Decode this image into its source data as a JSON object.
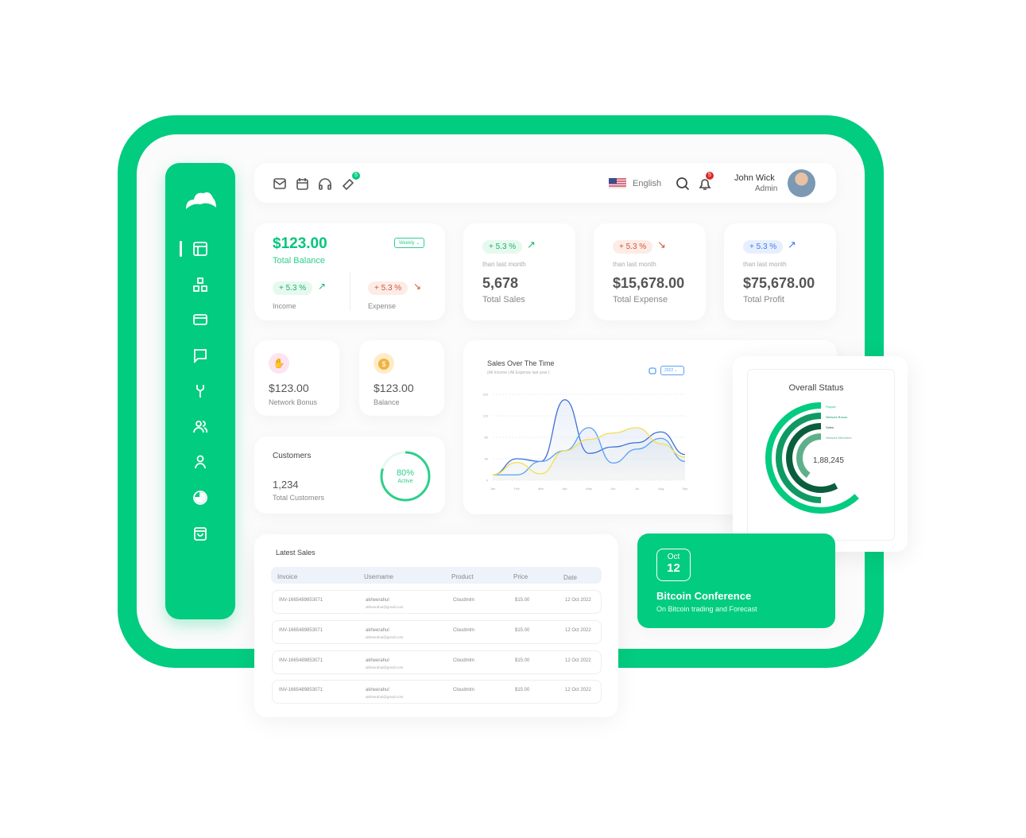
{
  "header": {
    "ticket_badge": "5",
    "language": "English",
    "notification_badge": "5",
    "user_name": "John Wick",
    "user_role": "Admin"
  },
  "sidebar": {
    "items": [
      "dashboard-icon",
      "network-icon",
      "card-icon",
      "chat-icon",
      "tools-icon",
      "users-icon",
      "user-icon",
      "chart-pie-icon",
      "shopping-bag-icon"
    ]
  },
  "balance": {
    "amount": "$123.00",
    "label": "Total Balance",
    "period": "Weekly",
    "income_change": "+ 5.3 %",
    "income_label": "Income",
    "expense_change": "+ 5.3 %",
    "expense_label": "Expense"
  },
  "stats": [
    {
      "change": "+ 5.3 %",
      "note": "than last month",
      "value": "5,678",
      "label": "Total Sales",
      "trend": "up",
      "color": "#1eb36b"
    },
    {
      "change": "+ 5.3 %",
      "note": "than last month",
      "value": "$15,678.00",
      "label": "Total Expense",
      "trend": "down",
      "color": "#d0573a"
    },
    {
      "change": "+ 5.3 %",
      "note": "than last month",
      "value": "$75,678.00",
      "label": "Total Profit",
      "trend": "up",
      "color": "#3f7bf0"
    }
  ],
  "mini": [
    {
      "value": "$123.00",
      "label": "Network Bonus"
    },
    {
      "value": "$123.00",
      "label": "Balance"
    }
  ],
  "customers": {
    "title": "Customers",
    "value": "1,234",
    "label": "Total Customers",
    "percent": 80,
    "percent_text": "80%",
    "active": "Active"
  },
  "chart_data": {
    "type": "area",
    "title": "Sales Over The Time",
    "subtitle": "(All Income | All Expense last year )",
    "year": "2022",
    "categories": [
      "Jan",
      "Feb",
      "Mar",
      "Apr",
      "May",
      "Jun",
      "Jul",
      "Aug",
      "Sep"
    ],
    "ylim": [
      0,
      160
    ],
    "yticks": [
      0,
      40,
      80,
      120,
      160
    ],
    "grid": true,
    "series": [
      {
        "color": "#3d6fd6",
        "values": [
          10,
          40,
          35,
          150,
          50,
          62,
          70,
          90,
          48
        ]
      },
      {
        "color": "#5aa0f5",
        "values": [
          10,
          10,
          35,
          55,
          98,
          32,
          58,
          78,
          35
        ]
      },
      {
        "color": "#f5df4d",
        "values": [
          10,
          33,
          12,
          55,
          76,
          88,
          98,
          68,
          43
        ]
      }
    ]
  },
  "overall": {
    "title": "Overall Status",
    "total": "1,88,245",
    "legend": [
      {
        "name": "Payout",
        "color": "#02cc7f",
        "fraction": 0.62
      },
      {
        "name": "Network Bonus",
        "color": "#0f9a63",
        "fraction": 0.5
      },
      {
        "name": "Sales",
        "color": "#0b5e3d",
        "fraction": 0.58
      },
      {
        "name": "Network Members",
        "color": "#5fb08a",
        "fraction": 0.4
      }
    ]
  },
  "sales": {
    "title": "Latest Sales",
    "columns": [
      "Invoice",
      "Username",
      "Product",
      "Price",
      "Date"
    ],
    "rows": [
      {
        "invoice": "INV-1665489853071",
        "user": "akheerahul",
        "email": "akheerahul@gmail.com",
        "product": "Cloudmlm",
        "price": "$15.00",
        "date": "12 Oct 2022"
      },
      {
        "invoice": "INV-1665489853071",
        "user": "akheerahul",
        "email": "akheerahul@gmail.com",
        "product": "Cloudmlm",
        "price": "$15.00",
        "date": "12 Oct 2022"
      },
      {
        "invoice": "INV-1665489853071",
        "user": "akheerahul",
        "email": "akheerahul@gmail.com",
        "product": "Cloudmlm",
        "price": "$15.00",
        "date": "12 Oct 2022"
      },
      {
        "invoice": "INV-1665489853071",
        "user": "akheerahul",
        "email": "akheerahul@gmail.com",
        "product": "Cloudmlm",
        "price": "$15.00",
        "date": "12 Oct 2022"
      }
    ]
  },
  "event": {
    "month": "Oct",
    "day": "12",
    "title": "Bitcoin Conference",
    "subtitle": "On Bitcoin trading and Forecast"
  }
}
